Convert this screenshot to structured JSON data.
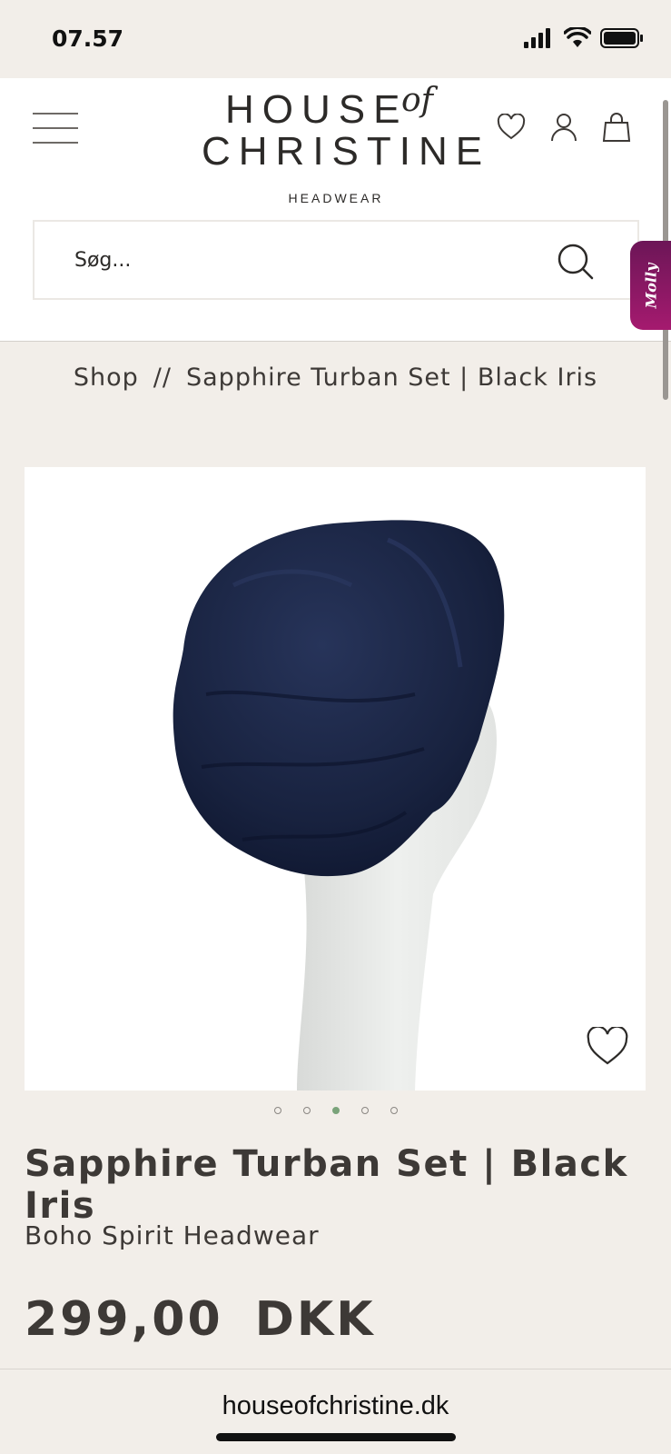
{
  "status_bar": {
    "time": "07.57"
  },
  "header": {
    "logo_line1": "HOUSE",
    "logo_of": "of",
    "logo_line2": "CHRISTINE",
    "logo_line3": "HEADWEAR"
  },
  "search": {
    "placeholder": "Søg..."
  },
  "molly": {
    "label": "Molly"
  },
  "breadcrumb": {
    "shop": "Shop",
    "separator": "//",
    "current": "Sapphire Turban Set | Black Iris"
  },
  "product": {
    "title": "Sapphire Turban Set | Black Iris",
    "subtitle": "Boho Spirit Headwear",
    "price": "299,00 DKK",
    "image_count": 5,
    "active_image": 3
  },
  "browser": {
    "url": "houseofchristine.dk"
  },
  "colors": {
    "background": "#f2eee9",
    "text": "#3d3936",
    "accent_dot": "#7aa37a",
    "molly": "#a51a6f"
  }
}
